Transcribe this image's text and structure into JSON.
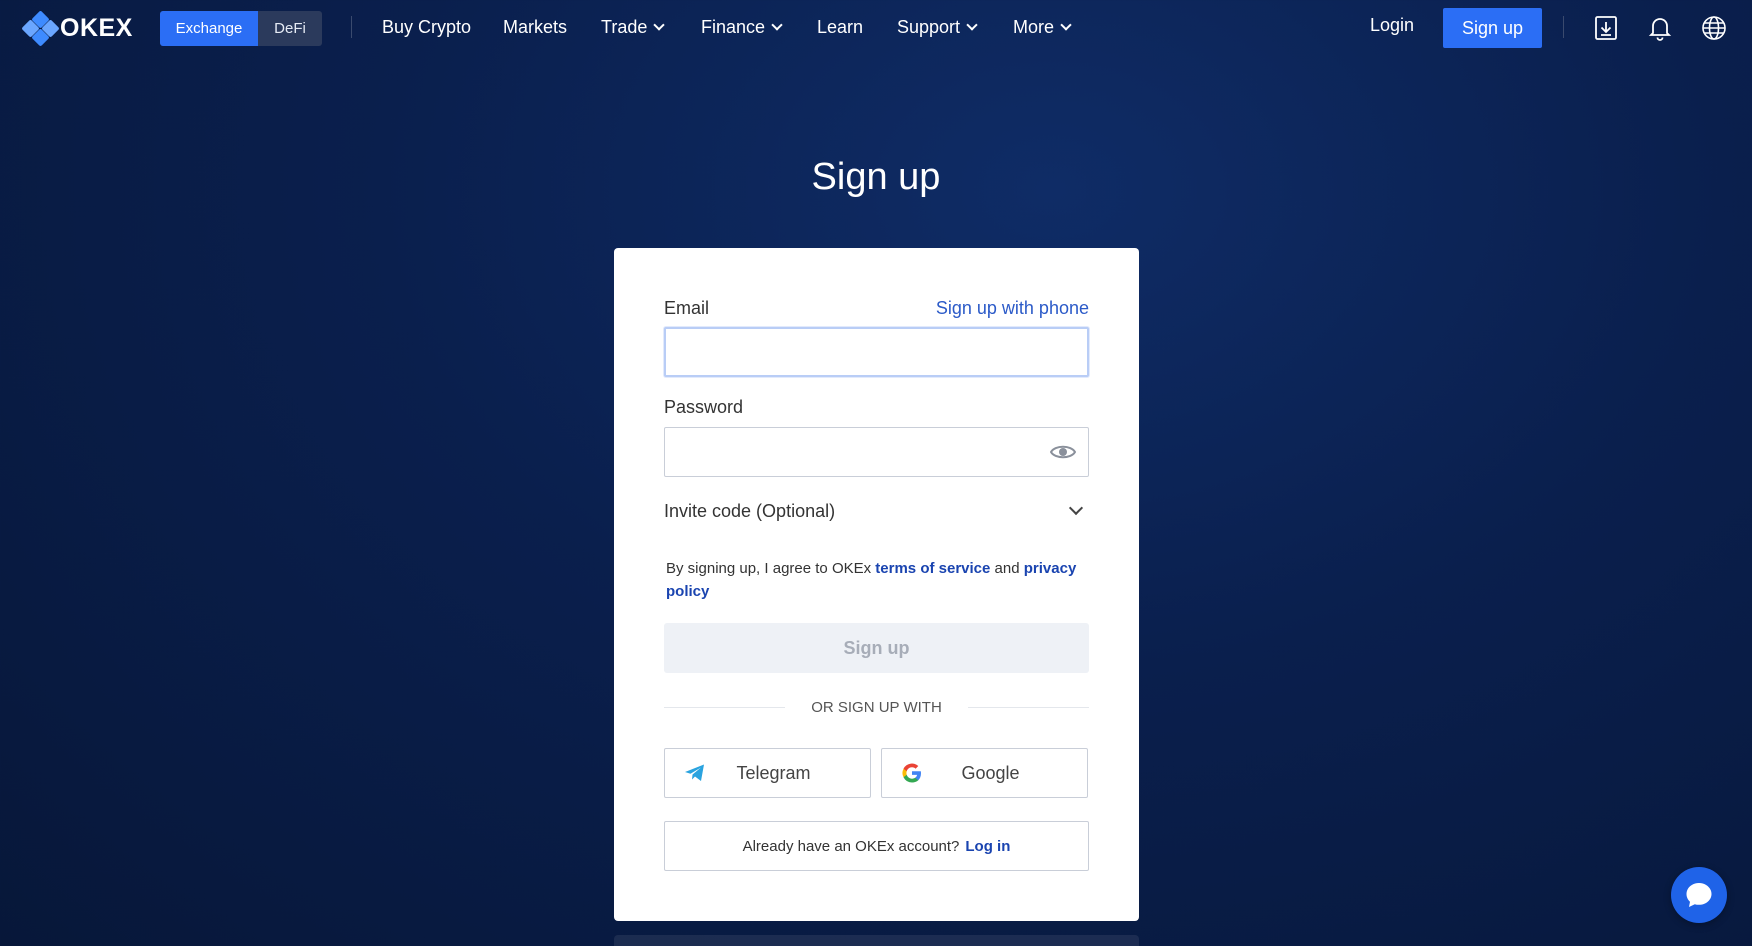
{
  "brand": {
    "logo_text": "OKEX"
  },
  "mode_switch": {
    "exchange": "Exchange",
    "defi": "DeFi"
  },
  "nav": {
    "items": [
      {
        "label": "Buy Crypto",
        "dropdown": false
      },
      {
        "label": "Markets",
        "dropdown": false
      },
      {
        "label": "Trade",
        "dropdown": true
      },
      {
        "label": "Finance",
        "dropdown": true
      },
      {
        "label": "Learn",
        "dropdown": false
      },
      {
        "label": "Support",
        "dropdown": true
      },
      {
        "label": "More",
        "dropdown": true
      }
    ],
    "login": "Login",
    "signup": "Sign up",
    "icons": [
      "download-icon",
      "bell-icon",
      "globe-icon"
    ]
  },
  "page": {
    "title": "Sign up"
  },
  "form": {
    "email_label": "Email",
    "phone_link": "Sign up with phone",
    "email_value": "",
    "password_label": "Password",
    "password_value": "",
    "invite_label": "Invite code (Optional)",
    "terms_prefix": "By signing up, I agree to OKEx ",
    "terms_link": "terms of service",
    "terms_and": " and ",
    "privacy_link": "privacy policy",
    "submit": "Sign up",
    "or_text": "OR SIGN UP WITH",
    "telegram": "Telegram",
    "google": "Google",
    "have_account": "Already have an OKEx account?",
    "login_link": "Log in"
  },
  "colors": {
    "accent": "#2b6ef5",
    "link": "#1a44b0",
    "bg": "#0a1f4d"
  }
}
